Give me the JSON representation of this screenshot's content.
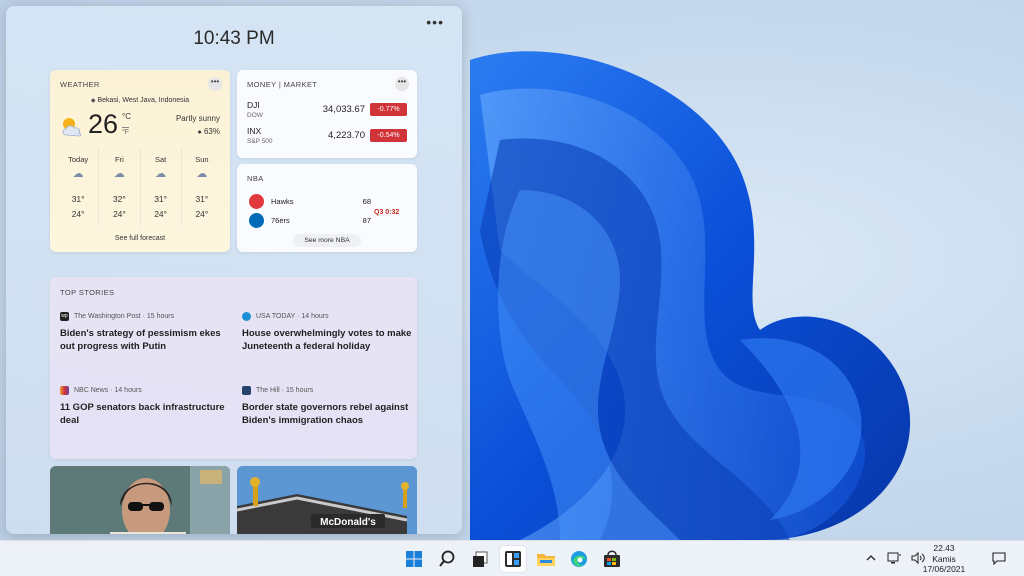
{
  "panel": {
    "clock": "10:43 PM",
    "more": "•••"
  },
  "weather": {
    "title": "WEATHER",
    "more": "•••",
    "location": "Bekasi, West Java, Indonesia",
    "temperature": "26",
    "unit_c": "°C",
    "unit_f": "°F",
    "condition": "Partly sunny",
    "humidity": "63%",
    "days": [
      {
        "name": "Today",
        "icon": "partly-cloudy-icon",
        "high": "31°",
        "low": "24°"
      },
      {
        "name": "Fri",
        "icon": "thunderstorm-icon",
        "high": "32°",
        "low": "24°"
      },
      {
        "name": "Sat",
        "icon": "rain-icon",
        "high": "31°",
        "low": "24°"
      },
      {
        "name": "Sun",
        "icon": "rain-icon",
        "high": "31°",
        "low": "24°"
      }
    ],
    "forecast_link": "See full forecast"
  },
  "money": {
    "title": "MONEY | MARKET",
    "more": "•••",
    "stocks": [
      {
        "symbol": "DJI",
        "exchange": "DOW",
        "price": "34,033.67",
        "change": "-0.77%"
      },
      {
        "symbol": "INX",
        "exchange": "S&P 500",
        "price": "4,223.70",
        "change": "-0.54%"
      }
    ],
    "negative_color": "#d13438"
  },
  "nba": {
    "title": "NBA",
    "teams": [
      {
        "name": "Hawks",
        "score": "68",
        "color": "#e03a3e"
      },
      {
        "name": "76ers",
        "score": "87",
        "color": "#006bb6"
      }
    ],
    "status": "Q3 0:32",
    "more_link": "See more NBA"
  },
  "stories": {
    "title": "TOP STORIES",
    "items": [
      {
        "source": "The Washington Post · 15 hours",
        "headline": "Biden's strategy of pessimism ekes out progress with Putin",
        "icon_color": "#222222",
        "icon_text": "wp"
      },
      {
        "source": "USA TODAY · 14 hours",
        "headline": "House overwhelmingly votes to make Juneteenth a federal holiday",
        "icon_color": "#1a8fd6",
        "icon_text": ""
      },
      {
        "source": "NBC News · 14 hours",
        "headline": "11 GOP senators back infrastructure deal",
        "icon_color": "#e8a23a",
        "icon_text": ""
      },
      {
        "source": "The Hill · 15 hours",
        "headline": "Border state governors rebel against Biden's immigration chaos",
        "icon_color": "#27446e",
        "icon_text": ""
      }
    ]
  },
  "photos": {
    "sign_text": "McDonald's"
  },
  "taskbar": {
    "icons": [
      "start-icon",
      "search-icon",
      "task-view-icon",
      "widgets-icon",
      "file-explorer-icon",
      "edge-icon",
      "store-icon"
    ],
    "time": "22.43",
    "day": "Kamis",
    "date": "17/06/2021"
  }
}
